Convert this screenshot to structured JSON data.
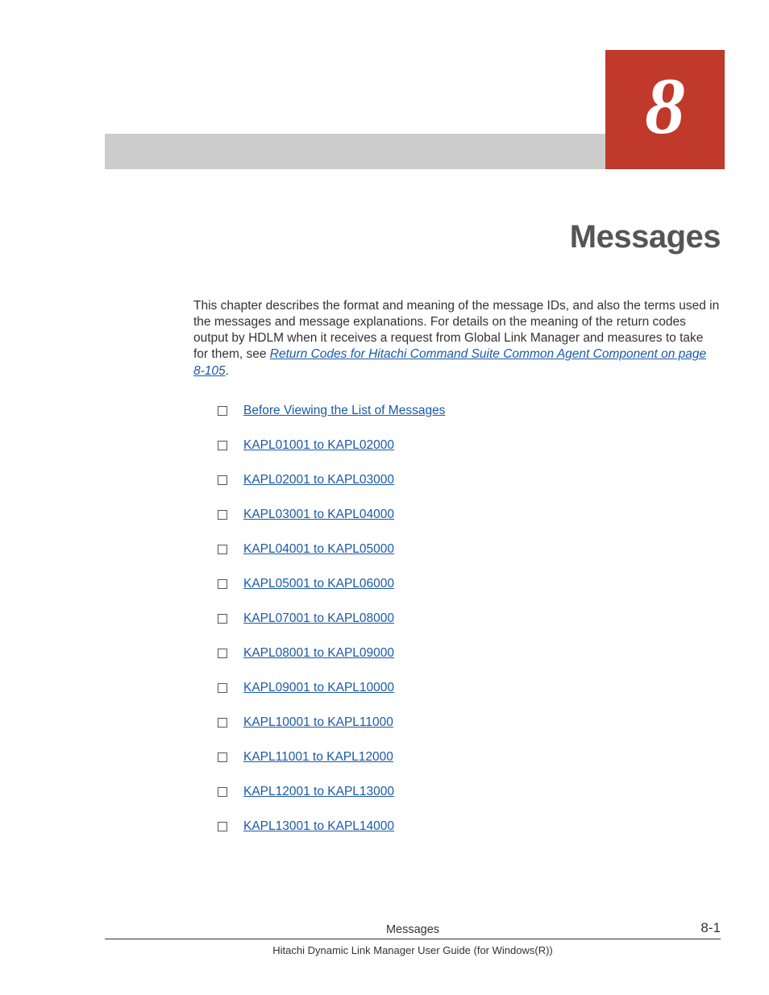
{
  "chapter": {
    "number": "8",
    "title": "Messages"
  },
  "intro": {
    "text_before_link": "This chapter describes the format and meaning of the message IDs, and also the terms used in the messages and message explanations. For details on the meaning of the return codes output by HDLM when it receives a request from Global Link Manager and measures to take for them, see ",
    "link_text": "Return Codes for Hitachi Command Suite Common Agent Component on page 8-105",
    "text_after_link": "."
  },
  "toc": [
    "Before Viewing the List of Messages",
    "KAPL01001 to KAPL02000",
    "KAPL02001 to KAPL03000",
    "KAPL03001 to KAPL04000",
    "KAPL04001 to KAPL05000",
    "KAPL05001 to KAPL06000",
    "KAPL07001 to KAPL08000",
    "KAPL08001 to KAPL09000",
    "KAPL09001 to KAPL10000",
    "KAPL10001 to KAPL11000",
    "KAPL11001 to KAPL12000",
    "KAPL12001 to KAPL13000",
    "KAPL13001 to KAPL14000"
  ],
  "footer": {
    "section": "Messages",
    "page_number": "8-1",
    "doc_title": "Hitachi Dynamic Link Manager User Guide (for Windows(R))"
  }
}
